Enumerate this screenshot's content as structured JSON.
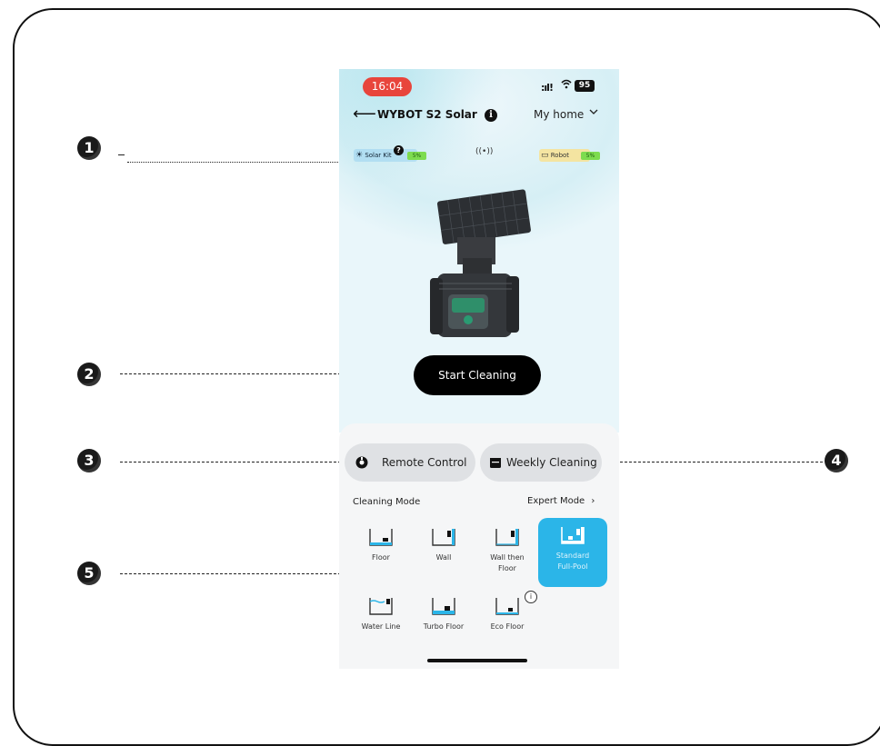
{
  "status_bar": {
    "time": "16:04",
    "battery": "95"
  },
  "header": {
    "title": "WYBOT S2 Solar",
    "info_icon": "info-icon",
    "location": "My home"
  },
  "devices": {
    "solar_kit_label": "Solar Kit",
    "solar_kit_battery": "5%",
    "robot_label": "Robot",
    "robot_battery": "5%"
  },
  "actions": {
    "start_cleaning": "Start Cleaning",
    "remote_control": "Remote Control",
    "weekly_cleaning": "Weekly Cleaning"
  },
  "cleaning": {
    "section_label": "Cleaning Mode",
    "expert_label": "Expert Mode",
    "modes": [
      {
        "label": "Floor",
        "active": false
      },
      {
        "label": "Wall",
        "active": false
      },
      {
        "label": "Wall then Floor",
        "active": false
      },
      {
        "label": "Standard Full-Pool",
        "active": true
      },
      {
        "label": "Water Line",
        "active": false
      },
      {
        "label": "Turbo Floor",
        "active": false
      },
      {
        "label": "Eco Floor",
        "active": false
      }
    ]
  },
  "callouts": [
    "1",
    "2",
    "3",
    "4",
    "5"
  ],
  "colors": {
    "accent": "#2bb5e8",
    "time_pill": "#e8453c",
    "primary_button": "#000000",
    "battery": "#7ddc4f"
  }
}
